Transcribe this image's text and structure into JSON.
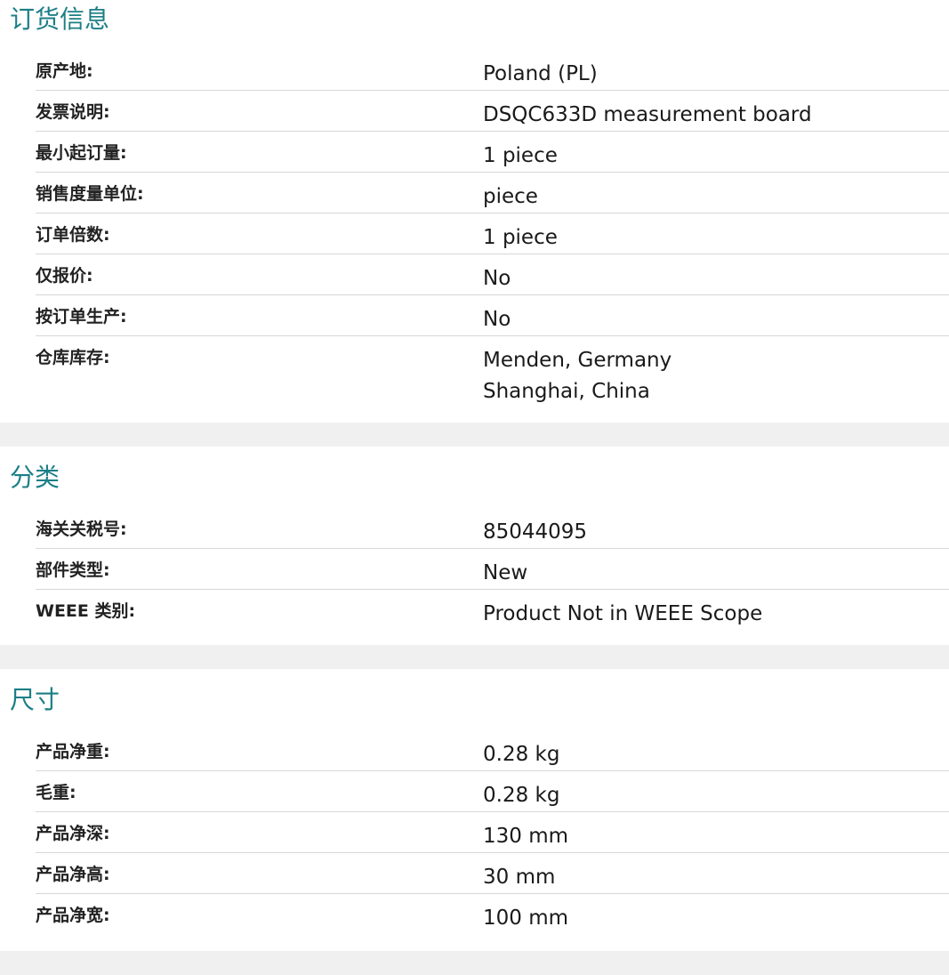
{
  "sections": {
    "order_info": {
      "title": "订货信息",
      "rows": [
        {
          "label": "原产地:",
          "value": "Poland (PL)"
        },
        {
          "label": "发票说明:",
          "value": "DSQC633D measurement board"
        },
        {
          "label": "最小起订量:",
          "value": "1 piece"
        },
        {
          "label": "销售度量单位:",
          "value": "piece"
        },
        {
          "label": "订单倍数:",
          "value": "1 piece"
        },
        {
          "label": "仅报价:",
          "value": "No"
        },
        {
          "label": "按订单生产:",
          "value": "No"
        },
        {
          "label": "仓库库存:",
          "values": [
            "Menden, Germany",
            "Shanghai, China"
          ]
        }
      ]
    },
    "classification": {
      "title": "分类",
      "rows": [
        {
          "label": "海关关税号:",
          "value": "85044095"
        },
        {
          "label": "部件类型:",
          "value": "New"
        },
        {
          "label": "WEEE 类别:",
          "value": "Product Not in WEEE Scope"
        }
      ]
    },
    "dimensions": {
      "title": "尺寸",
      "rows": [
        {
          "label": "产品净重:",
          "value": "0.28 kg"
        },
        {
          "label": "毛重:",
          "value": "0.28 kg"
        },
        {
          "label": "产品净深:",
          "value": "130 mm"
        },
        {
          "label": "产品净高:",
          "value": "30 mm"
        },
        {
          "label": "产品净宽:",
          "value": "100 mm"
        }
      ]
    }
  }
}
